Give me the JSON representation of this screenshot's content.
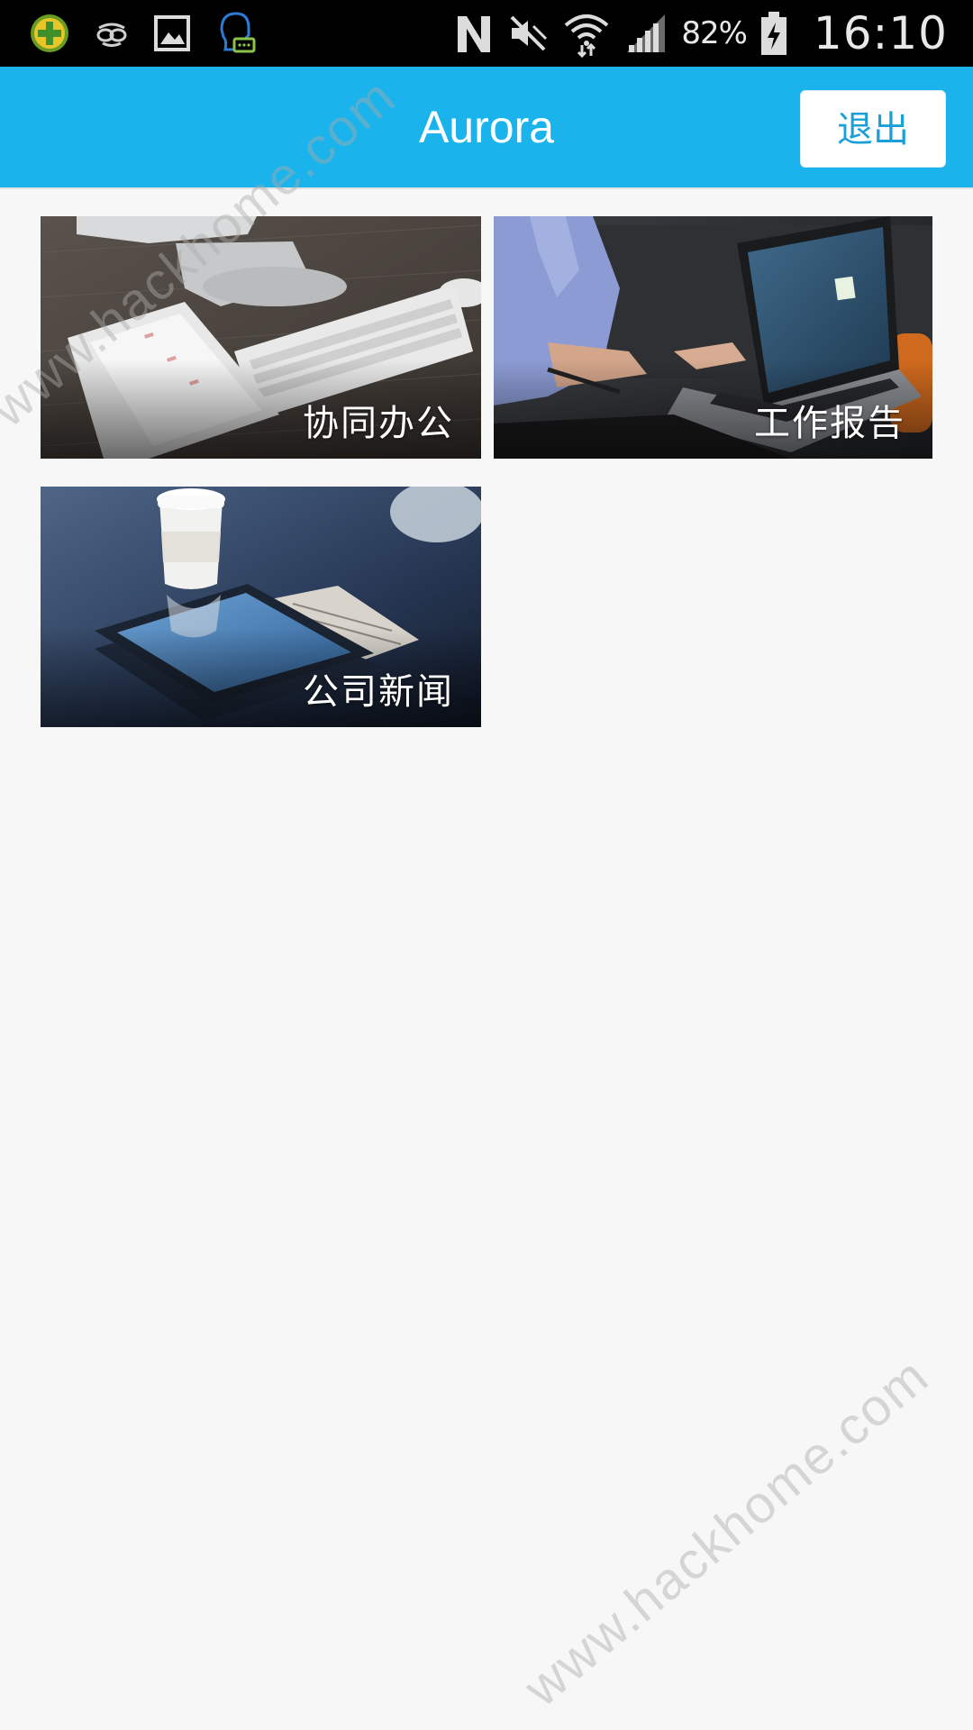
{
  "status_bar": {
    "battery_percent": "82%",
    "time": "16:10",
    "icons": [
      "app-plus-icon",
      "glasses-icon",
      "gallery-icon",
      "chat-assistant-icon",
      "nfc-icon",
      "mute-icon",
      "wifi-icon",
      "signal-icon",
      "battery-charging-icon"
    ]
  },
  "header": {
    "title": "Aurora",
    "logout_label": "退出",
    "color": "#1bb3ec"
  },
  "tiles": [
    {
      "label": "协同办公",
      "image": "desk-with-keyboard-and-tablet"
    },
    {
      "label": "工作报告",
      "image": "person-typing-on-laptop"
    },
    {
      "label": "公司新闻",
      "image": "coffee-cup-and-tablet-on-desk"
    }
  ],
  "watermark": {
    "text": "www.hackhome.com"
  }
}
